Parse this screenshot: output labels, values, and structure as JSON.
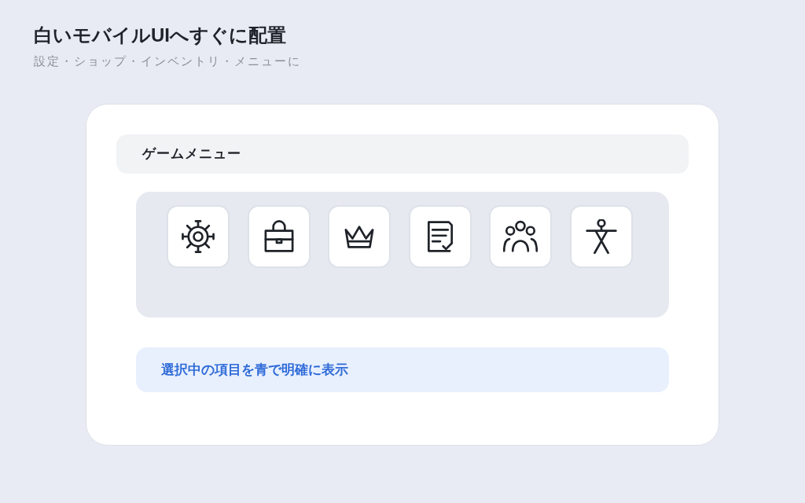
{
  "heading": {
    "title": "白いモバイルUIへすぐに配置",
    "subtitle": "設定・ショップ・インベントリ・メニューに"
  },
  "card": {
    "header": "ゲームメニュー",
    "tiles": [
      {
        "kind": "gear",
        "selected": false
      },
      {
        "kind": "bag",
        "selected": false
      },
      {
        "kind": "crown",
        "selected": false
      },
      {
        "kind": "checklist",
        "selected": false
      },
      {
        "kind": "group",
        "selected": false
      },
      {
        "kind": "figure",
        "selected": false
      }
    ],
    "note": "選択中の項目を青で明確に表示"
  }
}
